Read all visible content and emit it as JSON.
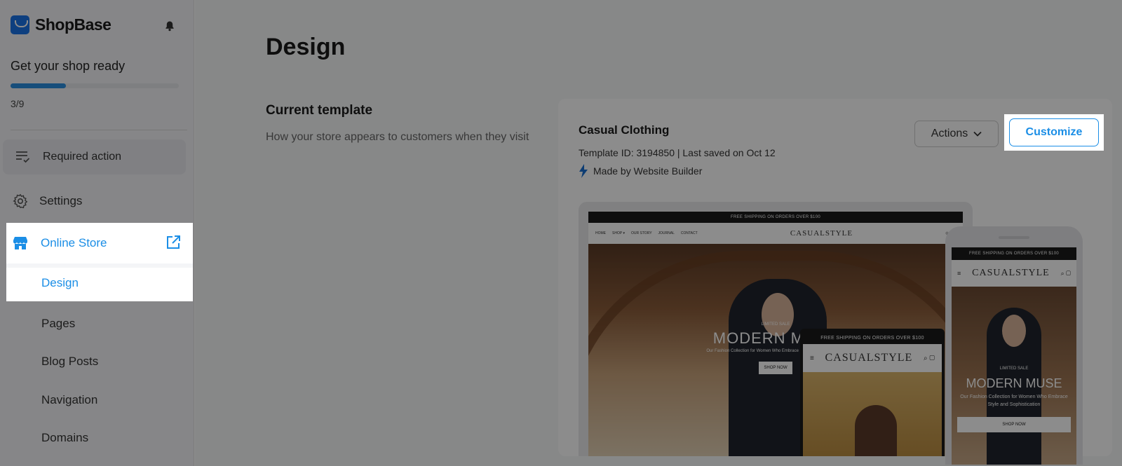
{
  "app": {
    "name": "ShopBase"
  },
  "sidebar": {
    "onboarding": {
      "title": "Get your shop ready",
      "progress": 0.33,
      "count": "3/9"
    },
    "required_action": "Required action",
    "settings": "Settings",
    "online_store": "Online Store",
    "items": [
      "Design",
      "Pages",
      "Blog Posts",
      "Navigation",
      "Domains"
    ]
  },
  "main": {
    "title": "Design",
    "section": {
      "title": "Current template",
      "description": "How your store appears to customers when they visit"
    },
    "template": {
      "name": "Casual Clothing",
      "meta": "Template ID: 3194850 | Last saved on Oct 12",
      "made_by": "Made by Website Builder",
      "actions_label": "Actions",
      "customize_label": "Customize"
    },
    "preview": {
      "announcement": "FREE SHIPPING ON ORDERS OVER $100",
      "nav_links": [
        "HOME",
        "SHOP ▾",
        "OUR STORY",
        "JOURNAL",
        "CONTACT"
      ],
      "logo": "CASUALSTYLE",
      "kicker": "LIMITED SALE",
      "headline": "MODERN MUSE",
      "subline": "Our Fashion Collection for Women Who Embrace Style and Sophistication",
      "cta": "SHOP NOW"
    }
  },
  "colors": {
    "accent": "#1b8ee6",
    "overlay": "rgba(0,0,0,0.45)"
  }
}
